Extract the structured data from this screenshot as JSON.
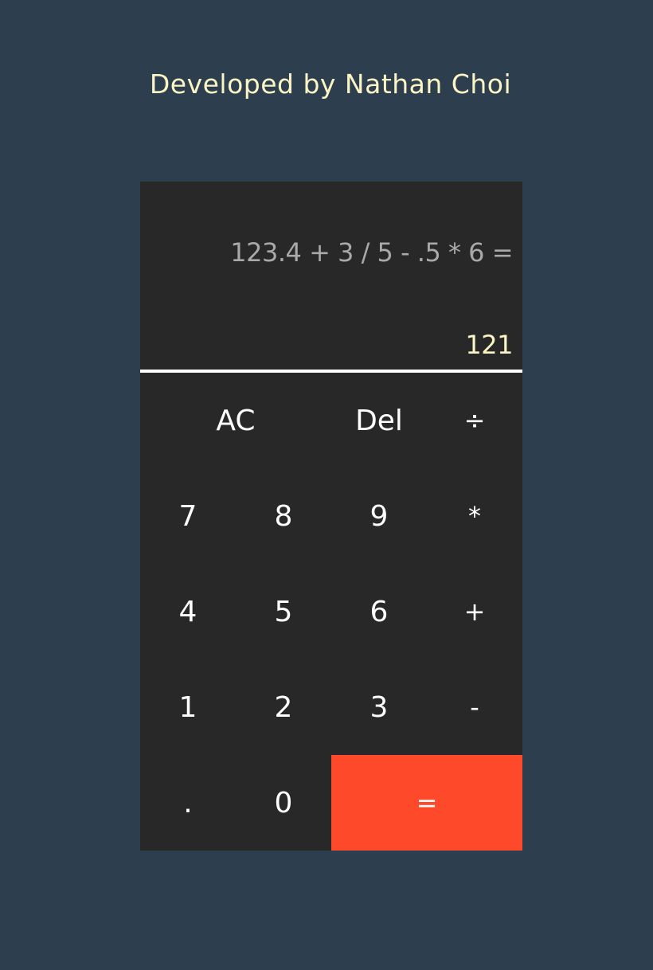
{
  "credit": "Developed by Nathan Choi",
  "display": {
    "expression": "123.4 + 3 / 5 - .5 * 6 =",
    "result": "121"
  },
  "keys": {
    "ac": "AC",
    "del": "Del",
    "divide": "÷",
    "seven": "7",
    "eight": "8",
    "nine": "9",
    "multiply": "*",
    "four": "4",
    "five": "5",
    "six": "6",
    "add": "+",
    "one": "1",
    "two": "2",
    "three": "3",
    "subtract": "-",
    "decimal": ".",
    "zero": "0",
    "equals": "="
  },
  "colors": {
    "background": "#2d3e4e",
    "calculator": "#282828",
    "accent": "#fe492a",
    "highlight_text": "#fbf4c4",
    "expression_text": "#a9a9a9"
  }
}
